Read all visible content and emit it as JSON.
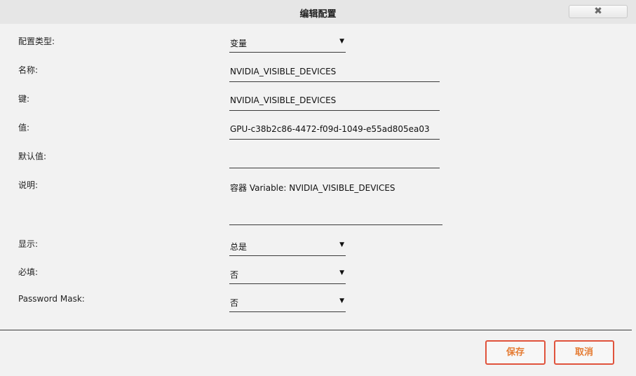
{
  "dialog": {
    "title": "编辑配置",
    "close_label": "✖"
  },
  "form": {
    "config_type": {
      "label": "配置类型:",
      "value": "变量"
    },
    "name": {
      "label": "名称:",
      "value": "NVIDIA_VISIBLE_DEVICES"
    },
    "key": {
      "label": "键:",
      "value": "NVIDIA_VISIBLE_DEVICES"
    },
    "value": {
      "label": "值:",
      "value": "GPU-c38b2c86-4472-f09d-1049-e55ad805ea03"
    },
    "default_value": {
      "label": "默认值:",
      "value": ""
    },
    "description": {
      "label": "说明:",
      "value": "容器 Variable: NVIDIA_VISIBLE_DEVICES"
    },
    "display": {
      "label": "显示:",
      "value": "总是"
    },
    "required": {
      "label": "必填:",
      "value": "否"
    },
    "password_mask": {
      "label": "Password Mask:",
      "value": "否"
    }
  },
  "footer": {
    "save_label": "保存",
    "cancel_label": "取消"
  },
  "icons": {
    "dropdown": "chevron-down-icon",
    "close": "close-icon"
  },
  "colors": {
    "button_border": "#e0533c",
    "button_text": "#e57b32",
    "background": "#f2f2f2"
  }
}
